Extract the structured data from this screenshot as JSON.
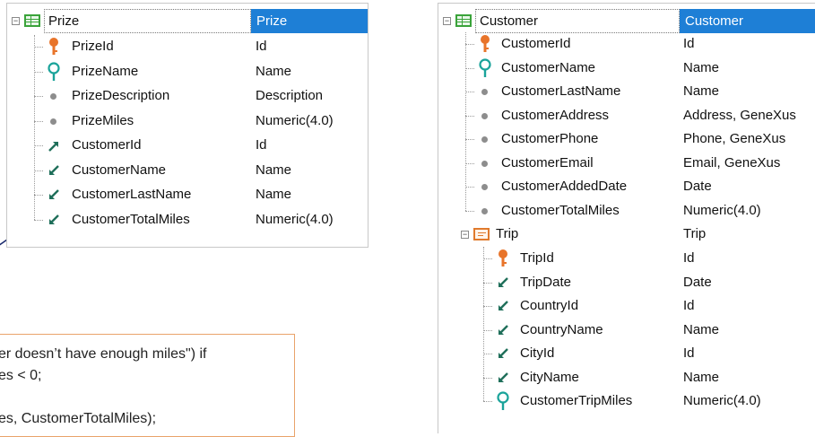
{
  "prize": {
    "name": "Prize",
    "type": "Prize",
    "attributes": [
      {
        "name": "PrizeId",
        "type": "Id",
        "icon": "key-icon"
      },
      {
        "name": "PrizeName",
        "type": "Name",
        "icon": "search-key-icon"
      },
      {
        "name": "PrizeDescription",
        "type": "Description",
        "icon": "dot-icon"
      },
      {
        "name": "PrizeMiles",
        "type": "Numeric(4.0)",
        "icon": "dot-icon"
      },
      {
        "name": "CustomerId",
        "type": "Id",
        "icon": "foreign-key-icon"
      },
      {
        "name": "CustomerName",
        "type": "Name",
        "icon": "inferred-icon"
      },
      {
        "name": "CustomerLastName",
        "type": "Name",
        "icon": "inferred-icon"
      },
      {
        "name": "CustomerTotalMiles",
        "type": "Numeric(4.0)",
        "icon": "inferred-icon"
      }
    ]
  },
  "customer": {
    "name": "Customer",
    "type": "Customer",
    "attributes": [
      {
        "name": "CustomerId",
        "type": "Id",
        "icon": "key-icon"
      },
      {
        "name": "CustomerName",
        "type": "Name",
        "icon": "search-key-icon"
      },
      {
        "name": "CustomerLastName",
        "type": "Name",
        "icon": "dot-icon"
      },
      {
        "name": "CustomerAddress",
        "type": "Address, GeneXus",
        "icon": "dot-icon"
      },
      {
        "name": "CustomerPhone",
        "type": "Phone, GeneXus",
        "icon": "dot-icon"
      },
      {
        "name": "CustomerEmail",
        "type": "Email, GeneXus",
        "icon": "dot-icon"
      },
      {
        "name": "CustomerAddedDate",
        "type": "Date",
        "icon": "dot-icon"
      },
      {
        "name": "CustomerTotalMiles",
        "type": "Numeric(4.0)",
        "icon": "dot-icon"
      }
    ],
    "level": {
      "name": "Trip",
      "type": "Trip",
      "attributes": [
        {
          "name": "TripId",
          "type": "Id",
          "icon": "key-icon"
        },
        {
          "name": "TripDate",
          "type": "Date",
          "icon": "inferred-icon"
        },
        {
          "name": "CountryId",
          "type": "Id",
          "icon": "inferred-icon"
        },
        {
          "name": "CountryName",
          "type": "Name",
          "icon": "inferred-icon"
        },
        {
          "name": "CityId",
          "type": "Id",
          "icon": "inferred-icon"
        },
        {
          "name": "CityName",
          "type": "Name",
          "icon": "inferred-icon"
        },
        {
          "name": "CustomerTripMiles",
          "type": "Numeric(4.0)",
          "icon": "search-key-icon"
        }
      ]
    }
  },
  "code": {
    "line1": "er doesn’t have enough miles\") if",
    "line2": "es < 0;",
    "line3": "es, CustomerTotalMiles);"
  },
  "colors": {
    "accent": "#1e7fd6",
    "key": "#e8742a",
    "search": "#1aa39a",
    "inferred": "#1f6f5a"
  }
}
